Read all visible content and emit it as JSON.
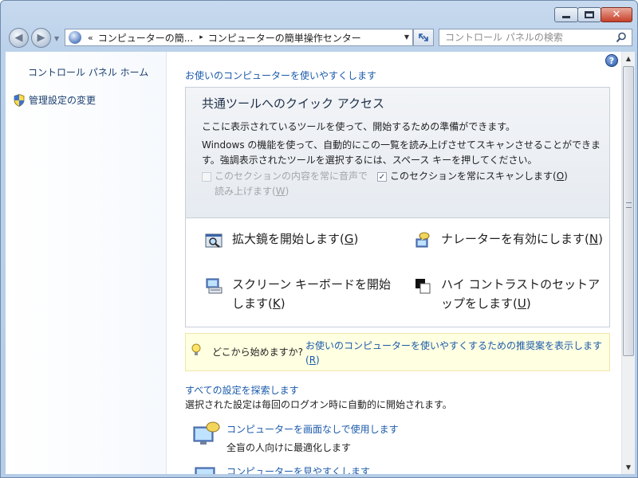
{
  "window": {
    "caption_buttons": {
      "minimize": "minimize",
      "maximize": "maximize",
      "close": "✕"
    }
  },
  "nav": {
    "address": {
      "chevron": "«",
      "segments": [
        "コンピューターの簡...",
        "コンピューターの簡単操作センター"
      ],
      "separator": "▸"
    },
    "search": {
      "placeholder": "コントロール パネルの検索"
    }
  },
  "sidebar": {
    "home": "コントロール パネル ホーム",
    "admin": "管理設定の変更"
  },
  "main": {
    "help": "?",
    "heading_link": "お使いのコンピューターを使いやすくします",
    "quick": {
      "title": "共通ツールへのクイック アクセス",
      "line1": "ここに表示されているツールを使って、開始するための準備ができます。",
      "line2": "Windows の機能を使って、自動的にこの一覧を読み上げさせてスキャンさせることができます。強調表示されたツールを選択するには、スペース キーを押してください。",
      "checkbox_read": {
        "label": "このセクションの内容を常に音声で読み上げます",
        "access": "W",
        "checked": false,
        "enabled": false
      },
      "checkbox_scan": {
        "label": "このセクションを常にスキャンします",
        "access": "O",
        "checked": true,
        "enabled": true
      },
      "tools": [
        {
          "label": "拡大鏡を開始します",
          "access": "G",
          "icon": "magnifier-icon"
        },
        {
          "label": "ナレーターを有効にします",
          "access": "N",
          "icon": "narrator-icon"
        },
        {
          "label": "スクリーン キーボードを開始します",
          "access": "K",
          "icon": "keyboard-icon"
        },
        {
          "label": "ハイ コントラストのセットアップをします",
          "access": "U",
          "icon": "contrast-icon"
        }
      ]
    },
    "tip": {
      "question": "どこから始めますか?",
      "link": "お使いのコンピューターを使いやすくするための推奨案を表示します",
      "access": "R"
    },
    "all_settings": {
      "link": "すべての設定を探索します",
      "note": "選択された設定は毎回のログオン時に自動的に開始されます。"
    },
    "items": [
      {
        "title": "コンピューターを画面なしで使用します",
        "desc": "全盲の人向けに最適化します"
      },
      {
        "title": "コンピューターを見やすくします",
        "desc": ""
      }
    ]
  }
}
